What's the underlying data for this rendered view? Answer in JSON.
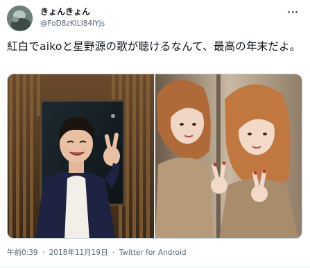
{
  "author": {
    "display_name": "きょんきょん",
    "handle": "@FoD8zKILI84IYjs"
  },
  "tweet": {
    "text": "紅白でaikoと星野源の歌が聴けるなんて、最高の年末だよ。"
  },
  "media": {
    "photos": [
      {
        "name": "studio-photo"
      },
      {
        "name": "mirror-selfie-photo"
      }
    ]
  },
  "meta": {
    "time": "午前0:39",
    "date": "2018年11月19日",
    "separator": "·",
    "source": "Twitter for Android"
  },
  "icons": {
    "more": "more-icon"
  }
}
